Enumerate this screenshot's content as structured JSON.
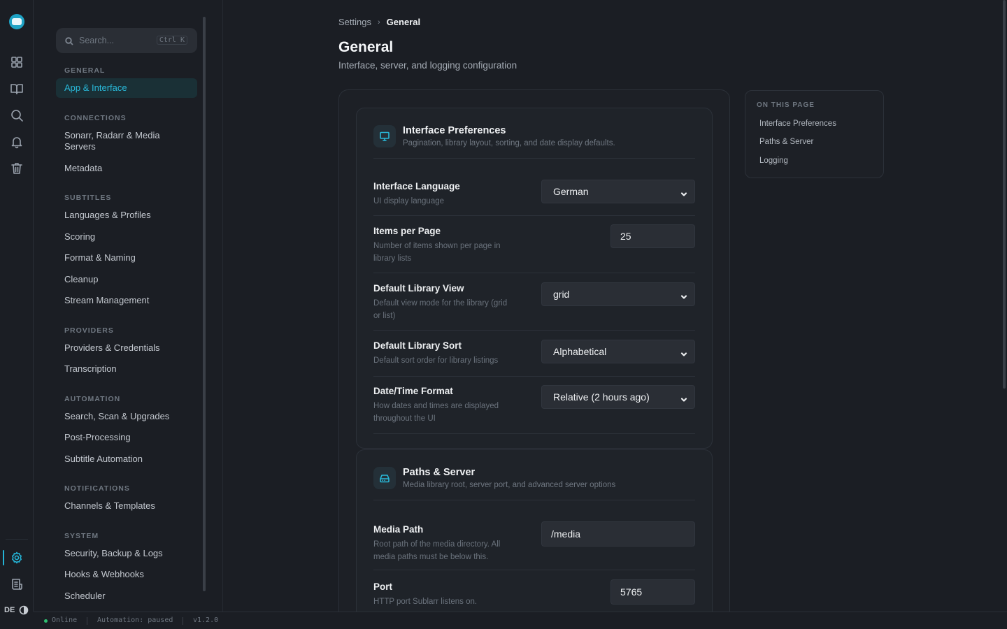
{
  "rail": {
    "icons": [
      "dashboard-icon",
      "library-icon",
      "search-icon",
      "bell-icon",
      "trash-icon",
      "settings-icon",
      "logs-icon"
    ],
    "language": "DE"
  },
  "search": {
    "placeholder": "Search...",
    "shortcut": "Ctrl K"
  },
  "nav": {
    "groups": {
      "general": "GENERAL",
      "connections": "CONNECTIONS",
      "subtitles": "SUBTITLES",
      "providers": "PROVIDERS",
      "automation": "AUTOMATION",
      "notifications": "NOTIFICATIONS",
      "system": "SYSTEM"
    },
    "items": {
      "app_interface": "App & Interface",
      "sonarr_radarr_line1": "Sonarr, Radarr & Media",
      "sonarr_radarr_line2": "Servers",
      "metadata": "Metadata",
      "languages_profiles": "Languages & Profiles",
      "scoring": "Scoring",
      "format_naming": "Format & Naming",
      "cleanup": "Cleanup",
      "stream_management": "Stream Management",
      "providers_credentials": "Providers & Credentials",
      "transcription": "Transcription",
      "search_scan_upgrades": "Search, Scan & Upgrades",
      "post_processing": "Post-Processing",
      "subtitle_automation": "Subtitle Automation",
      "channels_templates": "Channels & Templates",
      "security_backup_logs": "Security, Backup & Logs",
      "hooks_webhooks": "Hooks & Webhooks",
      "scheduler": "Scheduler"
    }
  },
  "breadcrumb": {
    "root": "Settings",
    "current": "General"
  },
  "page": {
    "title": "General",
    "subtitle": "Interface, server, and logging configuration"
  },
  "interface_card": {
    "title": "Interface Preferences",
    "subtitle": "Pagination, library layout, sorting, and date display defaults.",
    "rows": {
      "language": {
        "label": "Interface Language",
        "desc": "UI display language",
        "value": "German"
      },
      "items_per_page": {
        "label": "Items per Page",
        "desc": "Number of items shown per page in library lists",
        "value": "25"
      },
      "library_view": {
        "label": "Default Library View",
        "desc": "Default view mode for the library (grid or list)",
        "value": "grid"
      },
      "library_sort": {
        "label": "Default Library Sort",
        "desc": "Default sort order for library listings",
        "value": "Alphabetical"
      },
      "datetime": {
        "label": "Date/Time Format",
        "desc": "How dates and times are displayed throughout the UI",
        "value": "Relative (2 hours ago)"
      }
    }
  },
  "paths_card": {
    "title": "Paths & Server",
    "subtitle": "Media library root, server port, and advanced server options",
    "rows": {
      "media_path": {
        "label": "Media Path",
        "desc": "Root path of the media directory. All media paths must be below this.",
        "value": "/media"
      },
      "port": {
        "label": "Port",
        "desc": "HTTP port Sublarr listens on.",
        "value": "5765"
      }
    }
  },
  "toc": {
    "heading": "ON THIS PAGE",
    "items": [
      "Interface Preferences",
      "Paths & Server",
      "Logging"
    ]
  },
  "status": {
    "online": "Online",
    "automation": "Automation: paused",
    "version": "v1.2.0"
  },
  "colors": {
    "accent": "#29b9d9",
    "online": "#2fbf71",
    "background": "#1b1e24"
  }
}
